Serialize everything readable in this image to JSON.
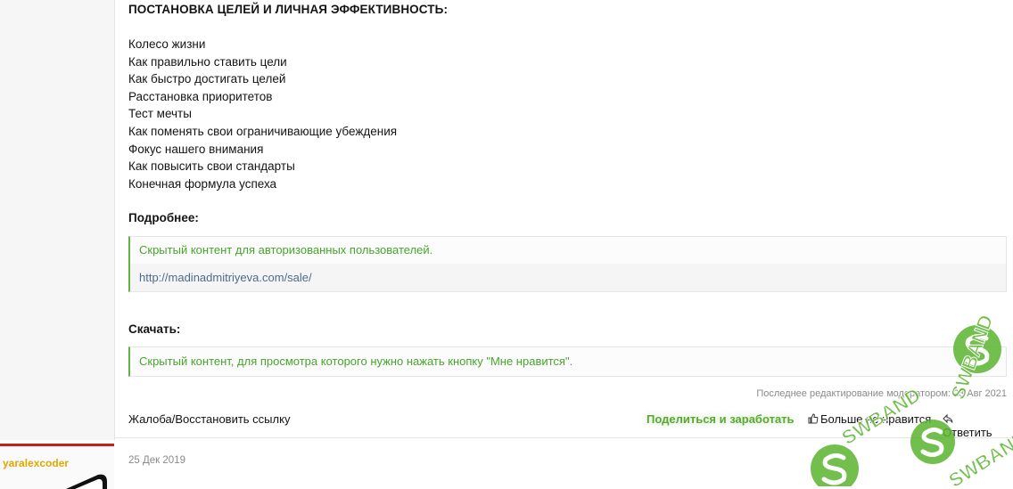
{
  "post": {
    "section_title": "ПОСТАНОВКА ЦЕЛЕЙ И ЛИЧНАЯ ЭФФЕКТИВНОСТЬ:",
    "items": [
      "Колесо жизни",
      "Как правильно ставить цели",
      "Как быстро достигать целей",
      "Расстановка приоритетов",
      "Тест мечты",
      "Как поменять свои ограничивающие убеждения",
      "Фокус нашего внимания",
      "Как повысить свои стандарты",
      "Конечная формула успеха"
    ],
    "more_label": "Подробнее:",
    "hidden_content_auth": "Скрытый контент для авторизованных пользователей.",
    "link": "http://madinadmitriyeva.com/sale/",
    "download_label": "Скачать:",
    "hidden_content_like": "Скрытый контент, для просмотра которого нужно нажать кнопку \"Мне нравится\".",
    "edited_note": "Последнее редактирование модератором: 23 Авг 2021"
  },
  "actions": {
    "complain": "Жалоба/Восстановить ссылку",
    "share": "Поделиться и заработать",
    "dislike": "Больше не нравится",
    "reply": "Ответить"
  },
  "next_post": {
    "author": "yaralexcoder",
    "date": "25 Дек 2019"
  },
  "watermark": {
    "text": "SWBAND",
    "color": "#5ab52f"
  }
}
